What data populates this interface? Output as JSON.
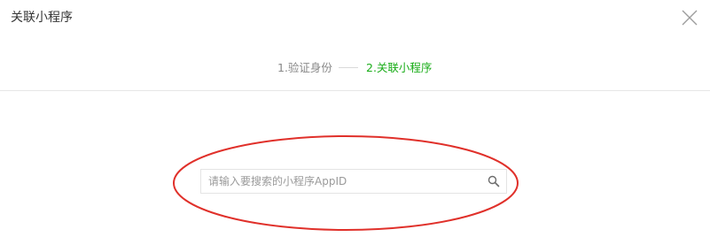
{
  "dialog": {
    "title": "关联小程序"
  },
  "steps": {
    "step1_label": "1.验证身份",
    "step2_label": "2.关联小程序",
    "active_color": "#1aad19",
    "inactive_color": "#888888"
  },
  "search": {
    "placeholder": "请输入要搜索的小程序AppID",
    "value": ""
  },
  "icons": {
    "close": "close-icon",
    "search": "search-icon"
  },
  "annotation_color": "#e0302a"
}
